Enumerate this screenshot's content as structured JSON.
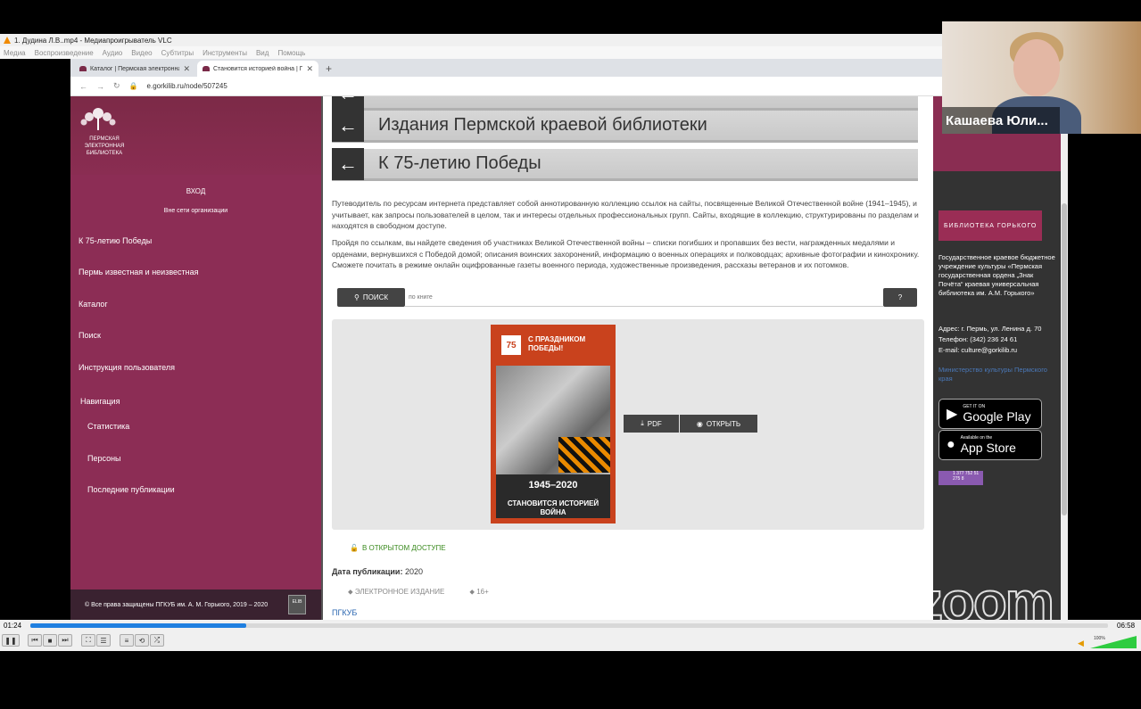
{
  "vlc": {
    "title": "1. Дудина Л.В..mp4 - Медиапроигрыватель VLC",
    "menu": [
      "Медиа",
      "Воспроизведение",
      "Аудио",
      "Видео",
      "Субтитры",
      "Инструменты",
      "Вид",
      "Помощь"
    ],
    "time_elapsed": "01:24",
    "time_total": "06:58",
    "progress": 0.2,
    "volume_label": "100%"
  },
  "browser": {
    "tabs": [
      {
        "label": "Каталог | Пермская электронна"
      },
      {
        "label": "Становится историей война | П"
      }
    ],
    "url": "e.gorkilib.ru/node/507245"
  },
  "sidebar": {
    "logo_text": "Пермская электронная библиотека",
    "login": "ВХОД",
    "offline": "Вне сети организации",
    "items": [
      "К 75-летию Победы",
      "Пермь известная и неизвестная",
      "Каталог",
      "Поиск",
      "Инструкция пользователя"
    ],
    "nav_title": "Навигация",
    "nav_items": [
      "Статистика",
      "Персоны",
      "Последние публикации"
    ],
    "footer": "© Все права защищены ПГКУБ им. А. М. Горького, 2019 – 2020",
    "footer_badge": "ELIB"
  },
  "main": {
    "headers": [
      "Издания Пермской краевой библиотеки",
      "К 75-летию Победы"
    ],
    "desc1": "Путеводитель по ресурсам интернета представляет собой аннотированную коллекцию ссылок на сайты, посвященные Великой Отечественной войне (1941–1945), и учитывает, как запросы пользователей в целом, так и интересы отдельных профессиональных групп. Сайты, входящие в коллекцию, структурированы по разделам и находятся в свободном доступе.",
    "desc2": "Пройдя по ссылкам, вы найдете сведения об участниках Великой Отечественной войны – списки погибших и пропавших без вести, награжденных медалями и орденами, вернувшихся с Победой домой; описания воинских захоронений, информацию о военных операциях и полководцах; архивные фотографии и кинохронику. Сможете почитать в режиме онлайн оцифрованные газеты военного периода, художественные произведения, рассказы ветеранов и их потомков.",
    "search_label": "ПОИСК",
    "search_placeholder": "по книге",
    "help_label": "?",
    "cover_badge": "75",
    "cover_title": "С праздником Победы!",
    "cover_years": "1945–2020",
    "cover_subtitle": "Становится историей война",
    "pdf_label": "PDF",
    "open_label": "ОТКРЫТЬ",
    "access_label": "В ОТКРЫТОМ ДОСТУПЕ",
    "pubdate_label": "Дата публикации:",
    "pubdate_value": "2020",
    "tag1": "ЭЛЕКТРОННОЕ ИЗДАНИЕ",
    "tag2": "16+",
    "pgkub": "ПГКУБ"
  },
  "right": {
    "lib_logo": "БИБЛИОТЕКА ГОРЬКОГО",
    "org": "Государственное краевое бюджетное учреждение культуры «Пермская государственная ордена „Знак Почёта“ краевая универсальная библиотека им. А.М. Горького»",
    "address": "Адрес: г. Пермь, ул. Ленина д. 70",
    "phone": "Телефон: (342) 236 24 61",
    "email": "E-mail: culture@gorkilib.ru",
    "ministry": "Министерство культуры Пермского края",
    "gplay_small": "GET IT ON",
    "gplay_big": "Google Play",
    "appstore_small": "Available on the",
    "appstore_big": "App Store",
    "counter": "1 377 752 51 275 8"
  },
  "zoom": {
    "participant": "Кашаева Юли...",
    "watermark": "zoom"
  }
}
